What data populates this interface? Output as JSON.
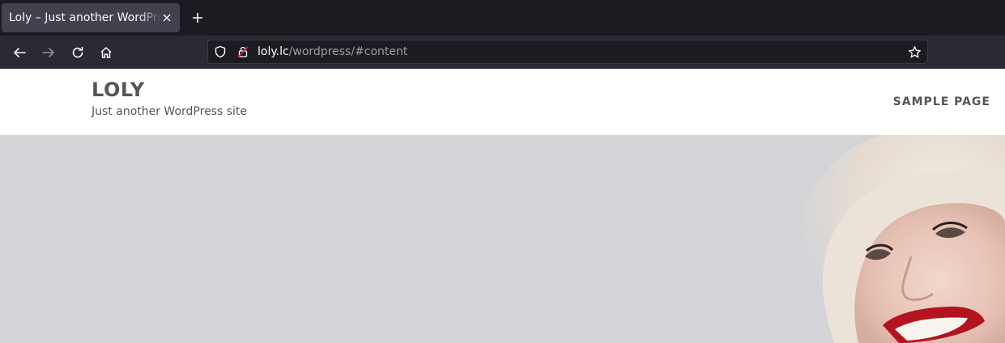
{
  "browser": {
    "tab": {
      "title": "Loly – Just another WordPress site"
    },
    "url": {
      "host": "loly.lc",
      "path": "/wordpress/#content"
    }
  },
  "site": {
    "title": "LOLY",
    "tagline": "Just another WordPress site",
    "nav": [
      {
        "label": "SAMPLE PAGE"
      }
    ]
  },
  "colors": {
    "tabstrip": "#1c1b22",
    "navbar": "#2b2a33",
    "hero_background": "#d3d4d8",
    "header_text": "#555555"
  }
}
